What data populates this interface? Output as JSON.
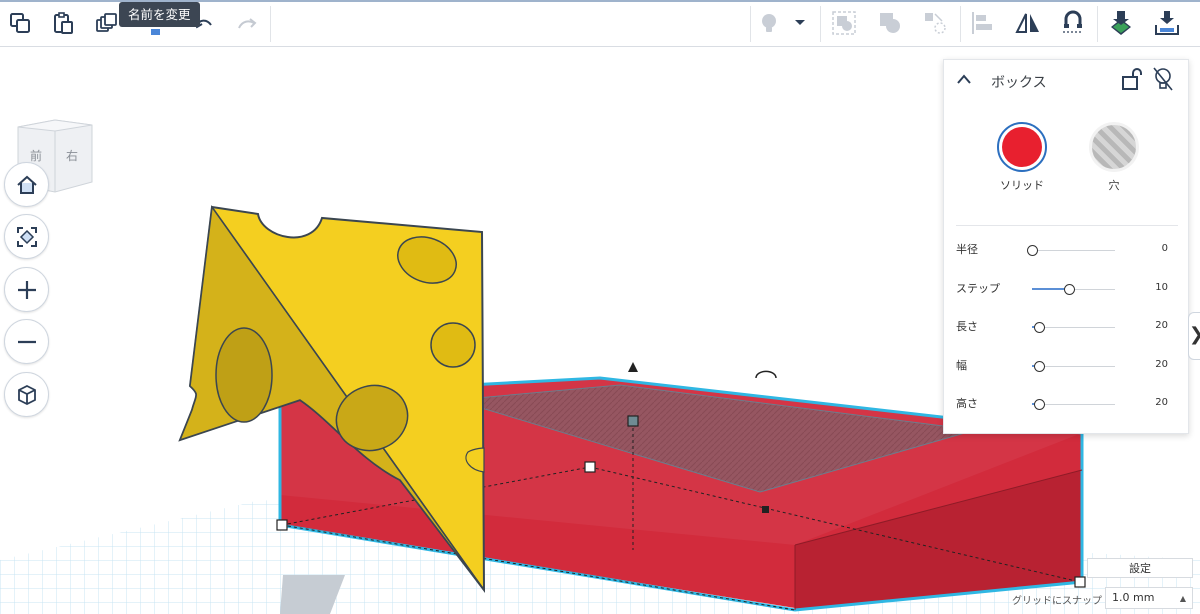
{
  "toolbar": {
    "tooltip": "名前を変更",
    "buttons": [
      "copy-icon",
      "paste-icon",
      "duplicate-icon",
      "delete-icon",
      "undo-icon",
      "redo-icon"
    ],
    "right_buttons": [
      "light-bulb-icon",
      "dropdown-icon",
      "group-icon",
      "ungroup-icon",
      "align-icon",
      "mirror-icon",
      "cruise-icon",
      "import-icon",
      "export-icon"
    ]
  },
  "viewcube": {
    "front": "前",
    "right": "右"
  },
  "nav": [
    "home-icon",
    "fit-view-icon",
    "zoom-in-icon",
    "zoom-out-icon",
    "perspective-icon"
  ],
  "inspector": {
    "title": "ボックス",
    "solid_label": "ソリッド",
    "hole_label": "穴",
    "params": [
      {
        "label": "半径",
        "value": "0",
        "fraction": 0.0
      },
      {
        "label": "ステップ",
        "value": "10",
        "fraction": 0.45
      },
      {
        "label": "長さ",
        "value": "20",
        "fraction": 0.09
      },
      {
        "label": "幅",
        "value": "20",
        "fraction": 0.09
      },
      {
        "label": "高さ",
        "value": "20",
        "fraction": 0.09
      }
    ],
    "colors": {
      "solid": "#e8202f",
      "hole": "#b8b8b8"
    }
  },
  "bottom": {
    "settings_label": "設定",
    "snap_label": "グリッドにスナップ",
    "snap_value": "1.0 mm"
  },
  "panel_toggle": "❯",
  "colors": {
    "box": "#d22b3c",
    "cheese": "#f4cf20",
    "accent": "#2fb7e3"
  }
}
